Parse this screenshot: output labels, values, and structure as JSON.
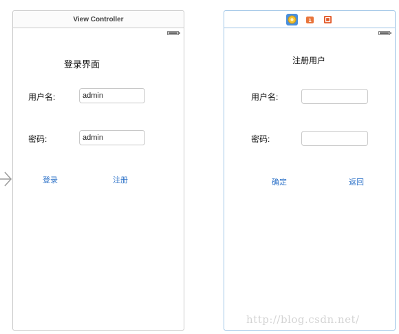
{
  "login_scene": {
    "title": "View Controller",
    "heading": "登录界面",
    "username_label": "用户名:",
    "username_value": "admin",
    "password_label": "密码:",
    "password_value": "admin",
    "login_button": "登录",
    "register_button": "注册"
  },
  "register_scene": {
    "dock_icons": [
      "view-controller-icon",
      "first-responder-icon",
      "exit-icon"
    ],
    "heading": "注册用户",
    "username_label": "用户名:",
    "username_value": "",
    "password_label": "密码:",
    "password_value": "",
    "confirm_button": "确定",
    "back_button": "返回"
  },
  "watermark": "http://blog.csdn.net/",
  "colors": {
    "accent": "#2d72c8",
    "selected_scene_border": "#9cc3e6",
    "scene_border": "#c9c9c9"
  }
}
